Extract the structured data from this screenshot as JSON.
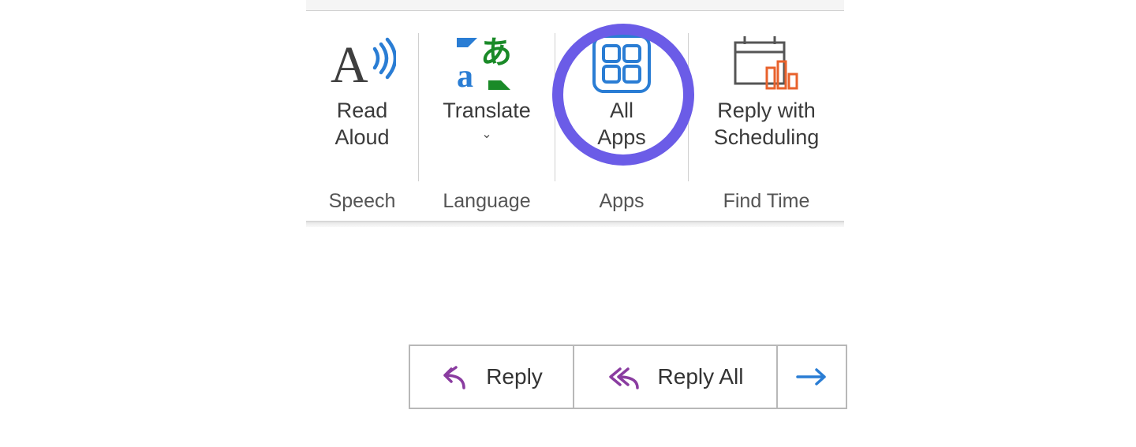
{
  "ribbon": {
    "groups": {
      "speech": {
        "name": "Speech",
        "button": {
          "label": "Read\nAloud"
        }
      },
      "language": {
        "name": "Language",
        "button": {
          "label": "Translate"
        }
      },
      "apps": {
        "name": "Apps",
        "button": {
          "label": "All\nApps"
        }
      },
      "findtime": {
        "name": "Find Time",
        "button": {
          "label": "Reply with\nScheduling"
        }
      }
    }
  },
  "actions": {
    "reply": "Reply",
    "reply_all": "Reply All"
  }
}
